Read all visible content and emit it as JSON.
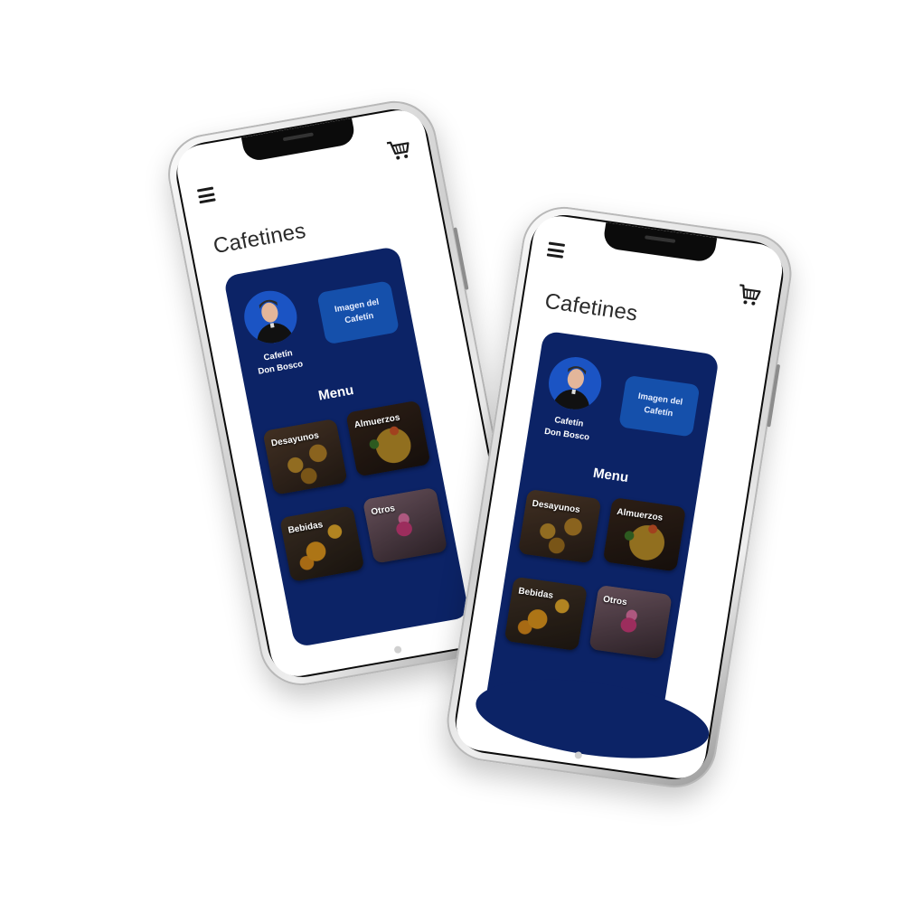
{
  "phones": [
    {
      "app": {
        "title": "Cafetines",
        "profile": {
          "name_line1": "Cafetín",
          "name_line2": "Don Bosco"
        },
        "image_card": "Imagen del Cafetín",
        "menu_heading": "Menu",
        "categories": [
          {
            "label": "Desayunos",
            "image": "breakfast-food"
          },
          {
            "label": "Almuerzos",
            "image": "lunch-food"
          },
          {
            "label": "Bebidas",
            "image": "drinks"
          },
          {
            "label": "Otros",
            "image": "dessert"
          }
        ]
      }
    },
    {
      "app": {
        "title": "Cafetines",
        "profile": {
          "name_line1": "Cafetín",
          "name_line2": "Don Bosco"
        },
        "image_card": "Imagen del Cafetín",
        "menu_heading": "Menu",
        "categories": [
          {
            "label": "Desayunos",
            "image": "breakfast-food"
          },
          {
            "label": "Almuerzos",
            "image": "lunch-food"
          },
          {
            "label": "Bebidas",
            "image": "drinks"
          },
          {
            "label": "Otros",
            "image": "dessert"
          }
        ]
      }
    }
  ],
  "icons": {
    "menu": "hamburger-menu-icon",
    "cart": "shopping-cart-icon"
  },
  "colors": {
    "panel": "#0c2366",
    "avatar_bg": "#1b54c4",
    "image_card": "#1550ab",
    "screen_bg": "#ffffff",
    "frame_silver": "#cfcfcf"
  }
}
